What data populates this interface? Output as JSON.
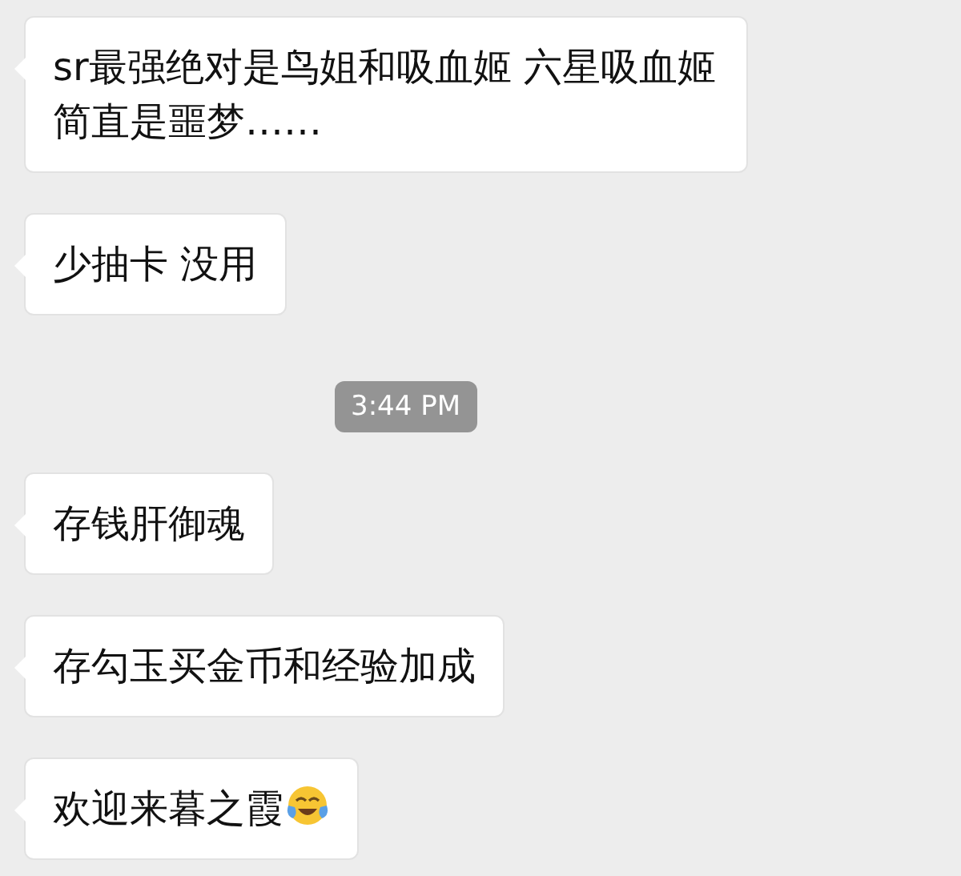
{
  "messages": [
    {
      "kind": "text",
      "text": "sr最强绝对是鸟姐和吸血姬 六星吸血姬简直是噩梦……",
      "trailing_emoji": false
    },
    {
      "kind": "text",
      "text": "少抽卡 没用",
      "trailing_emoji": false
    },
    {
      "kind": "time",
      "text": "3:44 PM"
    },
    {
      "kind": "text",
      "text": "存钱肝御魂",
      "trailing_emoji": false
    },
    {
      "kind": "text",
      "text": "存勾玉买金币和经验加成",
      "trailing_emoji": false
    },
    {
      "kind": "text",
      "text": "欢迎来暮之霞",
      "trailing_emoji": true
    }
  ]
}
